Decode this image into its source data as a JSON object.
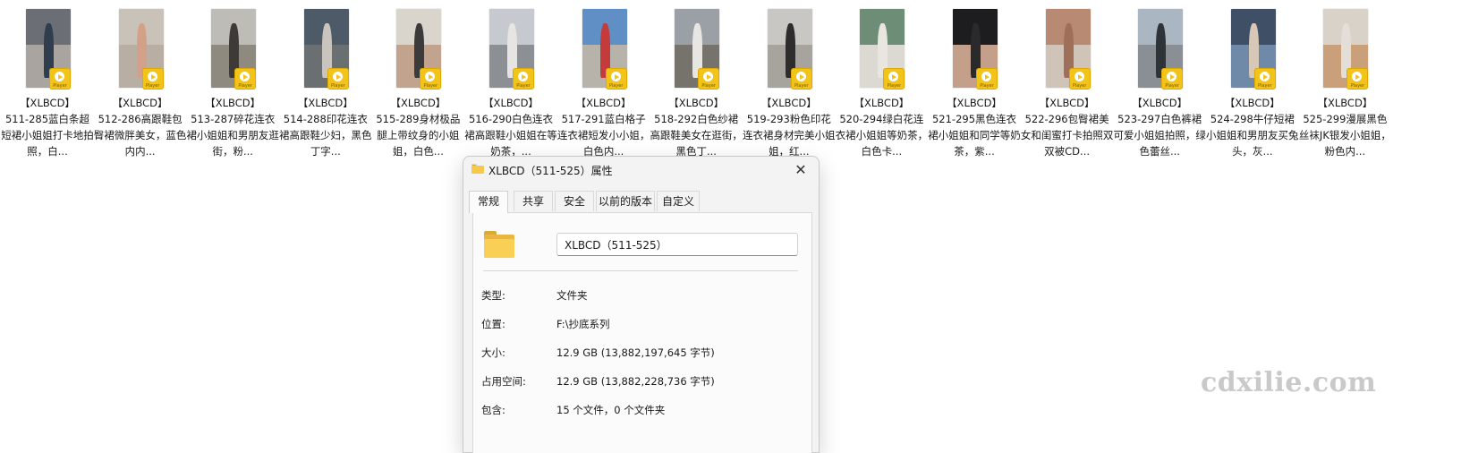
{
  "files": [
    {
      "line1": "【XLBCD】",
      "name": "511-285蓝白条超短裙小姐姐打卡地拍照，白...",
      "colors": [
        "#6b6f75",
        "#a9a49f",
        "#2f3d4f"
      ]
    },
    {
      "line1": "【XLBCD】",
      "name": "512-286高跟鞋包臀裙微胖美女，蓝色内内...",
      "colors": [
        "#c9c2b8",
        "#b8aea3",
        "#d3a18a"
      ]
    },
    {
      "line1": "【XLBCD】",
      "name": "513-287碎花连衣裙小姐姐和男朋友逛街，粉...",
      "colors": [
        "#bdbcb6",
        "#8f8a80",
        "#3d3a38"
      ]
    },
    {
      "line1": "【XLBCD】",
      "name": "514-288印花连衣裙高跟鞋少妇，黑色丁字...",
      "colors": [
        "#4d5a67",
        "#6a6f72",
        "#c9c4bd"
      ]
    },
    {
      "line1": "【XLBCD】",
      "name": "515-289身材极品腿上带纹身的小姐姐，白色...",
      "colors": [
        "#d9d4cc",
        "#c2a48e",
        "#3b3b3b"
      ]
    },
    {
      "line1": "【XLBCD】",
      "name": "516-290白色连衣裙高跟鞋小姐姐在等奶茶，...",
      "colors": [
        "#c6cad0",
        "#8c8f93",
        "#e7e5e2"
      ]
    },
    {
      "line1": "【XLBCD】",
      "name": "517-291蓝白格子连衣裙短发小小姐，白色内...",
      "colors": [
        "#5f8fc4",
        "#b7b2aa",
        "#c43b3b"
      ]
    },
    {
      "line1": "【XLBCD】",
      "name": "518-292白色纱裙高跟鞋美女在逛街，黑色丁...",
      "colors": [
        "#9aa0a5",
        "#76726c",
        "#e8e6e3"
      ]
    },
    {
      "line1": "【XLBCD】",
      "name": "519-293粉色印花连衣裙身材完美小姐姐，红...",
      "colors": [
        "#c9c7c3",
        "#a7a39d",
        "#2d2d2d"
      ]
    },
    {
      "line1": "【XLBCD】",
      "name": "520-294绿白花连衣裙小姐姐等奶茶，白色卡...",
      "colors": [
        "#6d8d77",
        "#dcd9d3",
        "#e9e6e1"
      ]
    },
    {
      "line1": "【XLBCD】",
      "name": "521-295黑色连衣裙小姐姐和同学等奶茶，紫...",
      "colors": [
        "#1d1d1f",
        "#c4a08b",
        "#2a2a2c"
      ]
    },
    {
      "line1": "【XLBCD】",
      "name": "522-296包臀裙美女和闺蜜打卡拍照双双被CD...",
      "colors": [
        "#b98a73",
        "#cfc4b7",
        "#a06f5a"
      ]
    },
    {
      "line1": "【XLBCD】",
      "name": "523-297白色裤裙可爱小姐姐拍照，绿色蕾丝...",
      "colors": [
        "#aab6c2",
        "#8a8f95",
        "#2e3338"
      ]
    },
    {
      "line1": "【XLBCD】",
      "name": "524-298牛仔短裙小姐姐和男朋友买兔头，灰...",
      "colors": [
        "#3e4f66",
        "#6f89a8",
        "#d7c7b6"
      ]
    },
    {
      "line1": "【XLBCD】",
      "name": "525-299漫展黑色丝袜JK银发小姐姐，粉色内...",
      "colors": [
        "#d8d2c8",
        "#c9a07a",
        "#e3ded7"
      ]
    }
  ],
  "player_badge_text": "Player",
  "dialog": {
    "title": "XLBCD（511-525）属性",
    "close_glyph": "✕",
    "tabs": [
      {
        "label": "常规",
        "active": true
      },
      {
        "label": "共享",
        "active": false
      },
      {
        "label": "安全",
        "active": false
      },
      {
        "label": "以前的版本",
        "active": false
      },
      {
        "label": "自定义",
        "active": false
      }
    ],
    "folder_name": "XLBCD（511-525）",
    "properties": [
      {
        "label": "类型:",
        "value": "文件夹"
      },
      {
        "label": "位置:",
        "value": "F:\\抄底系列"
      },
      {
        "label": "大小:",
        "value": "12.9 GB (13,882,197,645 字节)"
      },
      {
        "label": "占用空间:",
        "value": "12.9 GB (13,882,228,736 字节)"
      },
      {
        "label": "包含:",
        "value": "15 个文件，0 个文件夹"
      }
    ]
  },
  "watermark": "cdxilie.com"
}
